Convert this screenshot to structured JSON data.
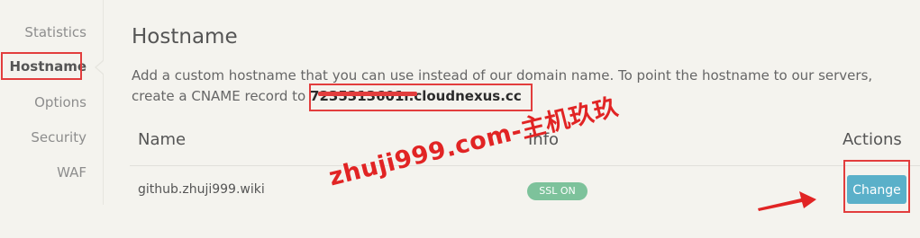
{
  "sidebar": {
    "items": [
      {
        "label": "Statistics"
      },
      {
        "label": "Hostname"
      },
      {
        "label": "Options"
      },
      {
        "label": "Security"
      },
      {
        "label": "WAF"
      }
    ]
  },
  "main": {
    "title": "Hostname",
    "description_line1": "Add a custom hostname that you can use instead of our domain name. To point the hostname to our servers,",
    "description_line2_prefix": "create a CNAME record to",
    "cname_target": "7235313601r.cloudnexus.cc",
    "table": {
      "headers": {
        "name": "Name",
        "info": "Info",
        "actions": "Actions"
      },
      "rows": [
        {
          "name": "github.zhuji999.wiki",
          "badge": "SSL ON",
          "action": "Change"
        }
      ]
    }
  },
  "watermark": "zhuji999.com-主机玖玖",
  "colors": {
    "background": "#f4f3ee",
    "annotation_red": "#e23d3d",
    "badge_green": "#7dc29b",
    "button_blue": "#5ab0c9"
  },
  "icons": {
    "annotation_arrow": "arrow-right-icon"
  }
}
